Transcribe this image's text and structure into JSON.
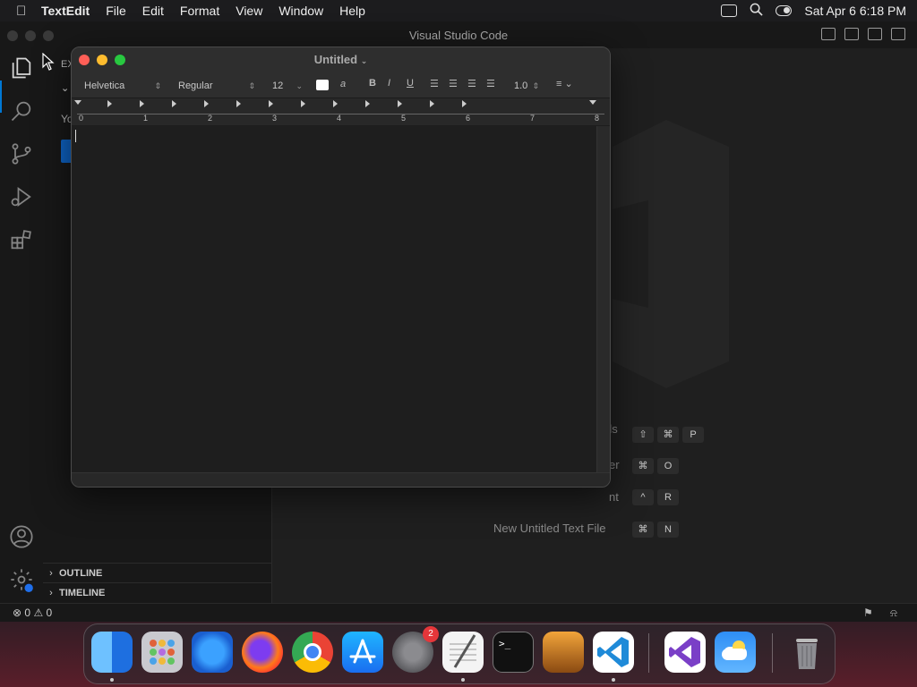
{
  "menubar": {
    "app_name": "TextEdit",
    "items": [
      "File",
      "Edit",
      "Format",
      "View",
      "Window",
      "Help"
    ],
    "clock": "Sat Apr 6  6:18 PM"
  },
  "vscode": {
    "window_title": "Visual Studio Code",
    "sidebar": {
      "header": "EX",
      "section": "N",
      "text": "Yo"
    },
    "panels": [
      "OUTLINE",
      "TIMELINE"
    ],
    "shortcuts": [
      {
        "label": "ds",
        "keys": [
          "⇧",
          "⌘",
          "P"
        ]
      },
      {
        "label": "er",
        "keys": [
          "⌘",
          "O"
        ]
      },
      {
        "label": "nt",
        "keys": [
          "^",
          "R"
        ]
      },
      {
        "label": "New Untitled Text File",
        "keys": [
          "⌘",
          "N"
        ]
      }
    ],
    "status": {
      "errors": "0",
      "warnings": "0"
    }
  },
  "textedit": {
    "title": "Untitled",
    "font_family": "Helvetica",
    "font_style": "Regular",
    "font_size": "12",
    "line_spacing": "1.0",
    "format_buttons": [
      "B",
      "I",
      "U"
    ],
    "ruler_numbers": [
      "0",
      "1",
      "2",
      "3",
      "4",
      "5",
      "6",
      "7",
      "8"
    ]
  },
  "dock": {
    "apps": [
      "Finder",
      "Launchpad",
      "Safari",
      "Firefox",
      "Chrome",
      "App Store",
      "System Settings",
      "TextEdit",
      "Terminal",
      "GarageBand",
      "Visual Studio Code",
      "Visual Studio",
      "Weather",
      "Trash"
    ],
    "settings_badge": "2"
  },
  "colors": {
    "traffic_red": "#ff5f57",
    "traffic_yellow": "#febc2e",
    "traffic_green": "#28c840",
    "vscode_accent": "#0078d4"
  }
}
